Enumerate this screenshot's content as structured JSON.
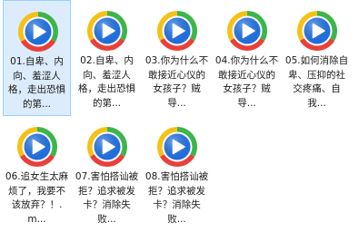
{
  "files": [
    {
      "name": "01.自卑、内向、羞涩人格，走出恐惧的第...",
      "icon": "media-player-icon",
      "selected": true
    },
    {
      "name": "02.自卑、内向、羞涩人格，走出恐惧的第...",
      "icon": "media-player-icon",
      "selected": false
    },
    {
      "name": "03.你为什么不敢接近心仪的女孩子？贼导...",
      "icon": "media-player-icon",
      "selected": false
    },
    {
      "name": "04.你为什么不敢接近心仪的女孩子？贼导...",
      "icon": "media-player-icon",
      "selected": false
    },
    {
      "name": "05.如何消除自卑、压抑的社交疼痛、自我...",
      "icon": "media-player-icon",
      "selected": false
    },
    {
      "name": "06.追女生太麻烦了，我要不该放弃？！.m...",
      "icon": "media-player-icon",
      "selected": false
    },
    {
      "name": "07.害怕搭讪被拒？追求被发卡？消除失败...",
      "icon": "media-player-icon",
      "selected": false
    },
    {
      "name": "08.害怕搭讪被拒？追求被发卡？消除失败...",
      "icon": "media-player-icon",
      "selected": false
    }
  ],
  "colors": {
    "selection_bg": "#dcecfc",
    "selection_border": "#99d1ff",
    "icon_green": "#3db54a",
    "icon_red": "#e8413a",
    "icon_yellow": "#f5c116",
    "icon_blue": "#1e73e8"
  }
}
